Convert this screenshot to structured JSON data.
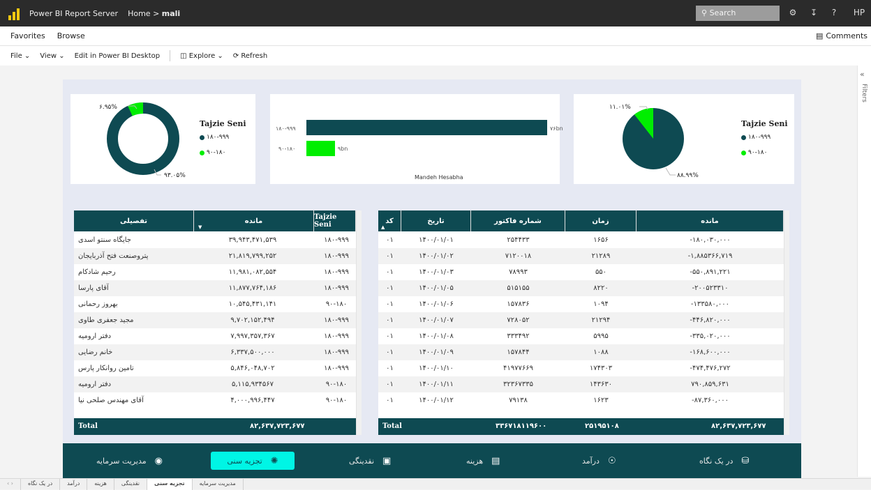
{
  "topbar": {
    "app": "Power BI Report Server",
    "home": "Home",
    "sep": ">",
    "page": "mali",
    "search_placeholder": "Search",
    "user": "HP",
    "help": "?"
  },
  "menubar": {
    "favorites": "Favorites",
    "browse": "Browse",
    "comments": "Comments"
  },
  "toolbar": {
    "file": "File",
    "view": "View",
    "edit": "Edit in Power BI Desktop",
    "explore": "Explore",
    "refresh": "Refresh"
  },
  "filters_label": "Filters",
  "colors": {
    "dark": "#0e4a52",
    "green": "#00ee00",
    "active_nav": "#00f5e5"
  },
  "donut": {
    "title": "Tajzie Seni",
    "legend": [
      "۱۸۰-۹۹۹",
      "۹۰-۱۸۰"
    ],
    "label_small": "۶.۹۵%",
    "label_big": "۹۳.۰۵%",
    "values": [
      93.05,
      6.95
    ]
  },
  "barchart": {
    "xlabel": "Mandeh Hesabha",
    "categories": [
      "۱۸۰-۹۹۹",
      "۹۰-۱۸۰"
    ],
    "labels": [
      "۷۶bn",
      "۹bn"
    ],
    "values": [
      76,
      9
    ]
  },
  "pie": {
    "title": "Tajzie Seni",
    "legend": [
      "۱۸۰-۹۹۹",
      "۹۰-۱۸۰"
    ],
    "label_small": "۱۱.۰۱%",
    "label_big": "۸۸.۹۹%",
    "values": [
      88.99,
      11.01
    ]
  },
  "left_table": {
    "headers": {
      "detail": "تفصیلی",
      "balance": "مانده",
      "tajzie": "Tajzie Seni"
    },
    "rows": [
      [
        "جایگاه سنتو اسدی",
        "۳۹,۹۴۳,۴۷۱,۵۳۹",
        "۱۸۰-۹۹۹"
      ],
      [
        "پتروصنعت فتح آذربایجان",
        "۲۱,۸۱۹,۷۹۹,۲۵۲",
        "۱۸۰-۹۹۹"
      ],
      [
        "رحیم شادکام",
        "۱۱,۹۸۱,۰۸۲,۵۵۴",
        "۱۸۰-۹۹۹"
      ],
      [
        "آقای پارسا",
        "۱۱,۸۷۷,۷۶۴,۱۸۶",
        "۱۸۰-۹۹۹"
      ],
      [
        "بهروز رحمانی",
        "۱۰,۵۴۵,۴۳۱,۱۴۱",
        "۹۰-۱۸۰"
      ],
      [
        "مجید جعفری طاوی",
        "۹,۷۰۲,۱۵۲,۴۹۴",
        "۱۸۰-۹۹۹"
      ],
      [
        "دفتر ارومیه",
        "۷,۹۹۷,۳۵۷,۳۶۷",
        "۱۸۰-۹۹۹"
      ],
      [
        "خانم رضایی",
        "۶,۳۳۷,۵۰۰,۰۰۰",
        "۱۸۰-۹۹۹"
      ],
      [
        "تامین روانکار پارس",
        "۵,۸۴۶,۰۴۸,۷۰۲",
        "۱۸۰-۹۹۹"
      ],
      [
        "دفتر ارومیه",
        "۵,۱۱۵,۹۳۴۵۶۷",
        "۹۰-۱۸۰"
      ],
      [
        "آقای مهندس صلحی نیا",
        "۴,۰۰۰,۹۹۶,۴۴۷",
        "۹۰-۱۸۰"
      ]
    ],
    "total_label": "Total",
    "total_value": "۸۲,۶۳۷,۷۲۳,۶۷۷"
  },
  "right_table": {
    "headers": {
      "code": "کد",
      "date": "تاریخ",
      "invoice": "شماره فاکتور",
      "time": "زمان",
      "balance": "مانده"
    },
    "rows": [
      [
        "۰۱",
        "۱۴۰۰/۰۱/۰۱",
        "۲۵۴۴۳۳",
        "۱۶۵۶",
        "-۱۸۰,۰۳۰,۰۰۰"
      ],
      [
        "۰۱",
        "۱۴۰۰/۰۱/۰۲",
        "۷۱۲۰۰۱۸",
        "۲۱۲۸۹",
        "-۱,۸۸۵۳۶۶,۷۱۹"
      ],
      [
        "۰۱",
        "۱۴۰۰/۰۱/۰۳",
        "۷۸۹۹۳",
        "۵۵۰",
        "-۵۵۰,۸۹۱,۲۲۱"
      ],
      [
        "۰۱",
        "۱۴۰۰/۰۱/۰۵",
        "۵۱۵۱۵۵",
        "۸۲۲۰",
        "-۲۰۰۵۲۳۳۱۰"
      ],
      [
        "۰۱",
        "۱۴۰۰/۰۱/۰۶",
        "۱۵۷۸۳۶",
        "۱۰۹۴",
        "-۱۳۳۵۸۰,۰۰۰"
      ],
      [
        "۰۱",
        "۱۴۰۰/۰۱/۰۷",
        "۷۲۸۰۵۲",
        "۲۱۲۹۴",
        "-۴۴۶,۸۲۰,۰۰۰"
      ],
      [
        "۰۱",
        "۱۴۰۰/۰۱/۰۸",
        "۳۳۳۴۹۲",
        "۵۹۹۵",
        "-۳۳۵,۰۲۰,۰۰۰"
      ],
      [
        "۰۱",
        "۱۴۰۰/۰۱/۰۹",
        "۱۵۷۸۴۴",
        "۱۰۸۸",
        "-۱۶۸,۶۰۰,۰۰۰"
      ],
      [
        "۰۱",
        "۱۴۰۰/۰۱/۱۰",
        "۴۱۹۷۷۶۶۹",
        "۱۷۴۳۰۳",
        "-۴۷۴,۴۷۶,۲۷۲"
      ],
      [
        "۰۱",
        "۱۴۰۰/۰۱/۱۱",
        "۳۲۳۶۷۳۳۵",
        "۱۴۳۶۳۰",
        "۷۹۰,۸۵۹,۶۳۱"
      ],
      [
        "۰۱",
        "۱۴۰۰/۰۱/۱۲",
        "۷۹۱۳۸",
        "۱۶۲۳",
        "-۸۷,۳۶۰,۰۰۰"
      ]
    ],
    "total_label": "Total",
    "total_invoice": "۳۳۶۷۱۸۱۱۹۶۰۰",
    "total_time": "۲۵۱۹۵۱۰۸",
    "total_value": "۸۲,۶۳۷,۷۲۳,۶۷۷"
  },
  "nav": {
    "capital": "مدیریت سرمایه",
    "age": "تجزیه سنی",
    "cash": "نقدینگی",
    "cost": "هزینه",
    "income": "درآمد",
    "glance": "در یک نگاه"
  },
  "tabs": [
    "در یک نگاه",
    "درآمد",
    "هزینه",
    "نقدینگی",
    "تجزیه سنی",
    "مدیریت سرمایه"
  ]
}
